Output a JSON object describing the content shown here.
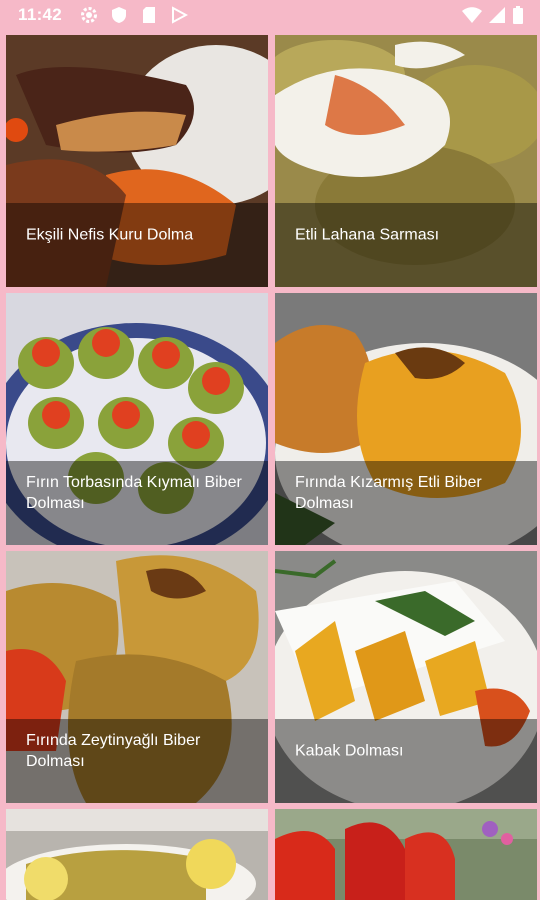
{
  "status_bar": {
    "time": "11:42",
    "left_icons": [
      "gear-icon",
      "shield-icon",
      "sd-card-icon",
      "play-store-icon"
    ],
    "right_icons": [
      "wifi-icon",
      "signal-icon",
      "battery-icon"
    ]
  },
  "recipes": [
    {
      "title": "Ekşili Nefis Kuru Dolma"
    },
    {
      "title": "Etli Lahana Sarması"
    },
    {
      "title": "Fırın Torbasında Kıymalı Biber Dolması"
    },
    {
      "title": "Fırında Kızarmış Etli Biber Dolması"
    },
    {
      "title": "Fırında Zeytinyağlı Biber Dolması"
    },
    {
      "title": "Kabak Dolması"
    },
    {
      "title": ""
    },
    {
      "title": ""
    }
  ],
  "colors": {
    "status_bar_bg": "#f6b9c8",
    "overlay": "rgba(0,0,0,0.42)",
    "title_text": "#ffffff"
  }
}
